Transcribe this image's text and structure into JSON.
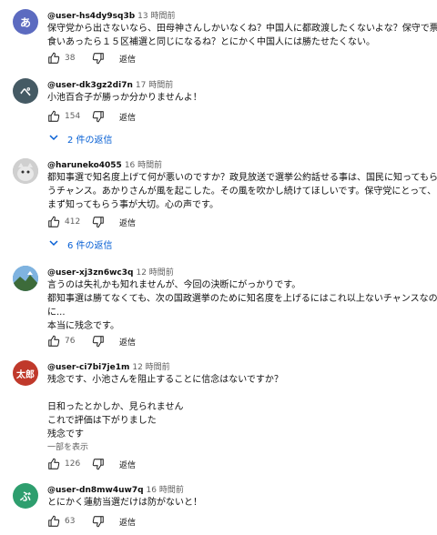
{
  "comments": [
    {
      "handle": "@user-hs4dy9sq3b",
      "time": "13 時間前",
      "avatar_text": "あ",
      "avatar_color": "#5c6bc0",
      "lines": [
        "保守党から出さないなら、田母神さんしかいなくね？中国人に都政渡したくないよな？保守で票",
        "食いあったら１５区補選と同じになるね？とにかく中国人には勝たせたくない。"
      ],
      "likes": "38",
      "reply_label": "返信"
    },
    {
      "handle": "@user-dk3gz2di7n",
      "time": "17 時間前",
      "avatar_text": "ぺ",
      "avatar_color": "#455a64",
      "lines": [
        "小池百合子が勝っか分かりませんよ！"
      ],
      "likes": "154",
      "reply_label": "返信",
      "thread": "2 件の返信"
    },
    {
      "handle": "@haruneko4055",
      "time": "16 時間前",
      "avatar_text": "",
      "avatar_color": "#bdbdbd",
      "lines": [
        "都知事選で知名度上げて何が悪いのですか？政見放送で選挙公約話せる事は、国民に知ってもら",
        "うチャンス。あかりさんが風を起こした。その風を吹かし続けてほしいです。保守党にとって、",
        "まず知ってもらう事が大切。心の声です。"
      ],
      "likes": "412",
      "reply_label": "返信",
      "thread": "6 件の返信"
    },
    {
      "handle": "@user-xj3zn6wc3q",
      "time": "12 時間前",
      "avatar_text": "",
      "avatar_color": "#4a90c2",
      "lines": [
        "言うのは失礼かも知れませんが、今回の決断にがっかりです。",
        "都知事選は勝てなくても、次の国政選挙のために知名度を上げるにはこれ以上ないチャンスなの",
        "に...",
        "本当に残念です。"
      ],
      "likes": "76",
      "reply_label": "返信"
    },
    {
      "handle": "@user-ci7bi7je1m",
      "time": "12 時間前",
      "avatar_text": "太郎",
      "avatar_color": "#c0392b",
      "lines": [
        "残念です、小池さんを阻止することに信念はないですか？",
        "",
        "日和ったとかしか、見られません",
        "これで評価は下がりました",
        "残念です"
      ],
      "more": "一部を表示",
      "likes": "126",
      "reply_label": "返信"
    },
    {
      "handle": "@user-dn8mw4uw7q",
      "time": "16 時間前",
      "avatar_text": "ぶ",
      "avatar_color": "#2e9e6e",
      "lines": [
        "とにかく蓮舫当選だけは防がないと！"
      ],
      "likes": "63",
      "reply_label": "返信"
    }
  ]
}
